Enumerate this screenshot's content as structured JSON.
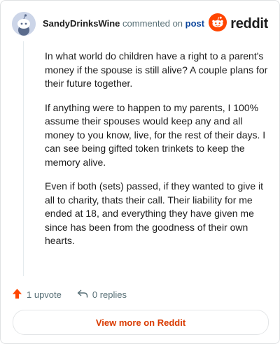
{
  "header": {
    "author": "SandyDrinksWine",
    "action": "commented on",
    "post_link": "post",
    "logo_text": "reddit"
  },
  "comment": {
    "paragraphs": [
      "In what world do children have a right to a parent's money if the spouse is still alive? A couple plans for their future together.",
      "If anything were to happen to my parents, I 100% assume their spouses would keep any and all money to you know, live, for the rest of their days. I can see being gifted token trinkets to keep the memory alive.",
      "Even if both (sets) passed, if they wanted to give it all to charity, thats their call. Their liability for me ended at 18, and everything they have given me since has been from the goodness of their own hearts."
    ]
  },
  "footer": {
    "upvotes": "1 upvote",
    "replies": "0 replies"
  },
  "button": {
    "view_more": "View more on Reddit"
  },
  "colors": {
    "brand": "#ff4500",
    "link": "#0a449b",
    "cta": "#d93a00",
    "muted": "#576f76"
  },
  "icons": {
    "avatar": "snoo-avatar-icon",
    "logo": "reddit-logo-icon",
    "upvote": "upvote-arrow-icon",
    "reply": "reply-arrow-icon"
  }
}
